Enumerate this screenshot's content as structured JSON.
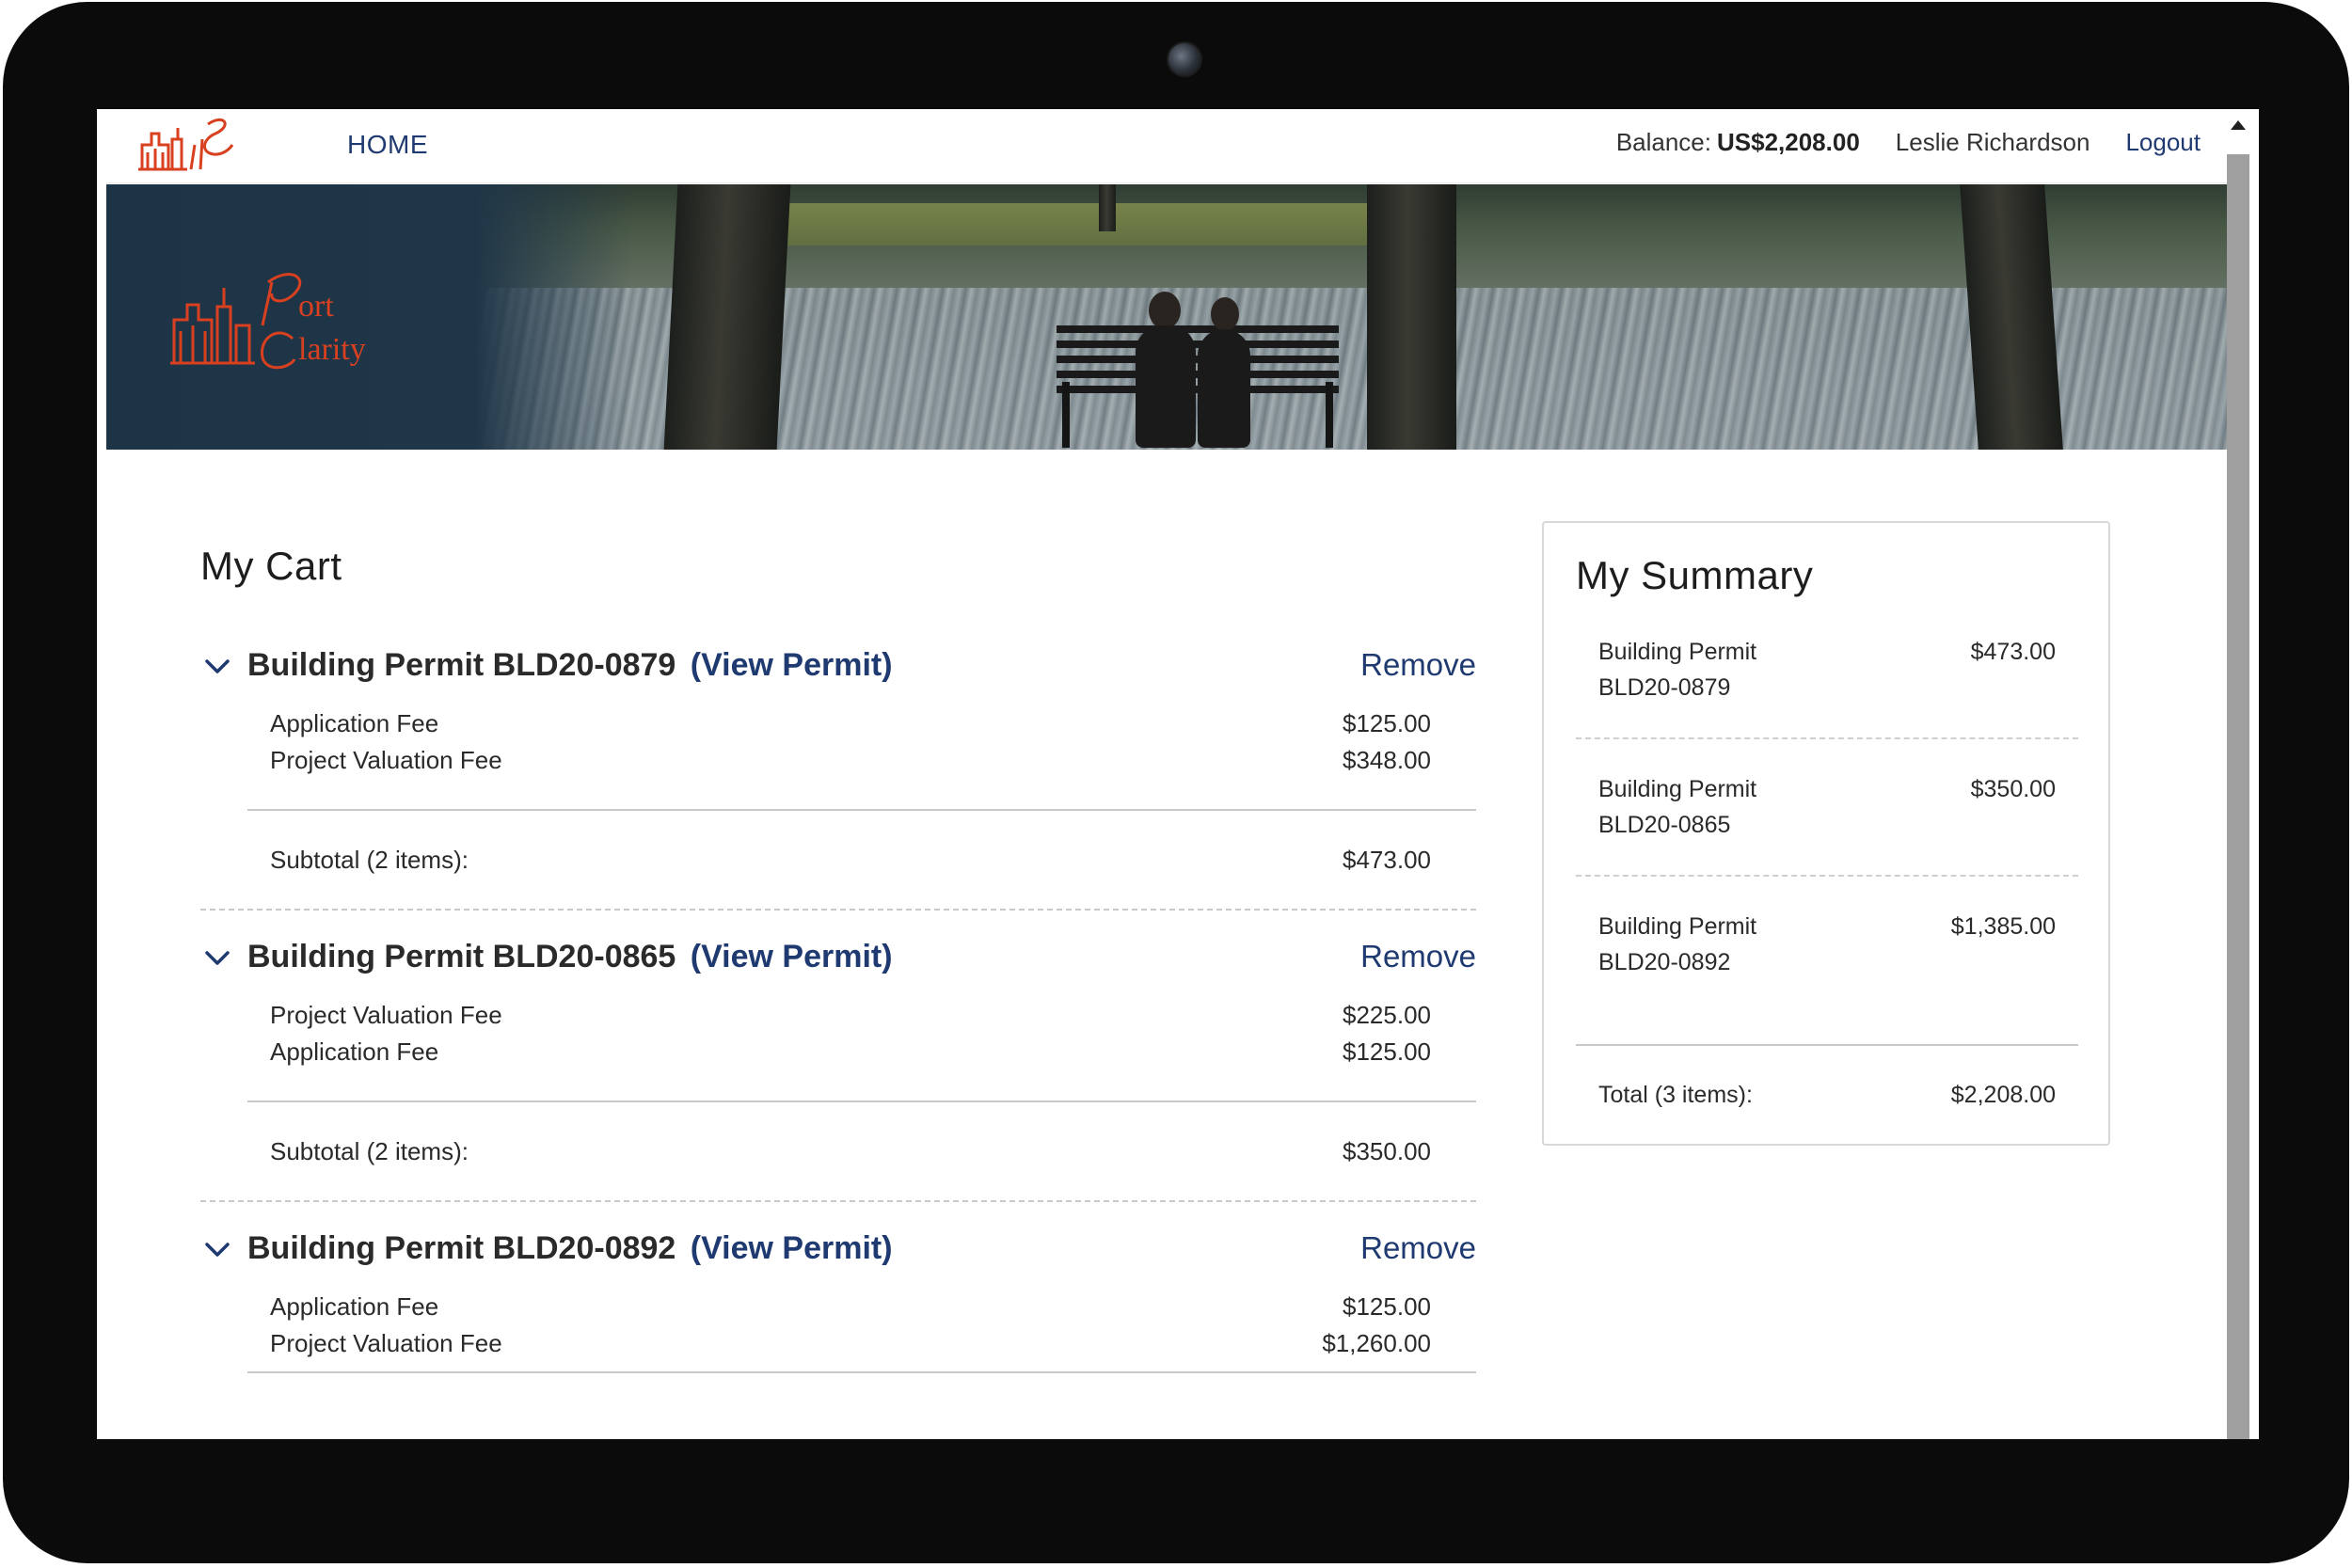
{
  "nav": {
    "home_label": "HOME",
    "balance_label": "Balance:",
    "balance_value": "US$2,208.00",
    "user_name": "Leslie Richardson",
    "logout_label": "Logout"
  },
  "banner": {
    "logo_line1": "ort",
    "logo_line2": "larity",
    "logo_initial1": "P",
    "logo_initial2": "C"
  },
  "cart": {
    "title": "My Cart",
    "remove_label": "Remove",
    "view_permit_label": "(View Permit)",
    "permits": [
      {
        "title": "Building Permit BLD20-0879",
        "fees": [
          {
            "label": "Application Fee",
            "amount": "$125.00"
          },
          {
            "label": "Project Valuation Fee",
            "amount": "$348.00"
          }
        ],
        "subtotal_label": "Subtotal (2 items):",
        "subtotal_amount": "$473.00"
      },
      {
        "title": "Building Permit BLD20-0865",
        "fees": [
          {
            "label": "Project Valuation Fee",
            "amount": "$225.00"
          },
          {
            "label": "Application Fee",
            "amount": "$125.00"
          }
        ],
        "subtotal_label": "Subtotal (2 items):",
        "subtotal_amount": "$350.00"
      },
      {
        "title": "Building Permit BLD20-0892",
        "fees": [
          {
            "label": "Application Fee",
            "amount": "$125.00"
          },
          {
            "label": "Project Valuation Fee",
            "amount": "$1,260.00"
          }
        ]
      }
    ]
  },
  "summary": {
    "title": "My Summary",
    "items": [
      {
        "line1": "Building Permit",
        "line2": "BLD20-0879",
        "amount": "$473.00"
      },
      {
        "line1": "Building Permit",
        "line2": "BLD20-0865",
        "amount": "$350.00"
      },
      {
        "line1": "Building Permit",
        "line2": "BLD20-0892",
        "amount": "$1,385.00"
      }
    ],
    "total_label": "Total (3 items):",
    "total_amount": "$2,208.00"
  },
  "colors": {
    "link_blue": "#1f3a70",
    "brand_orange": "#d9401f",
    "banner_navy": "#1f3648"
  },
  "icons": {
    "expand": "chevron-down-icon",
    "scroll_up": "arrow-up-icon",
    "camera": "camera-icon"
  }
}
